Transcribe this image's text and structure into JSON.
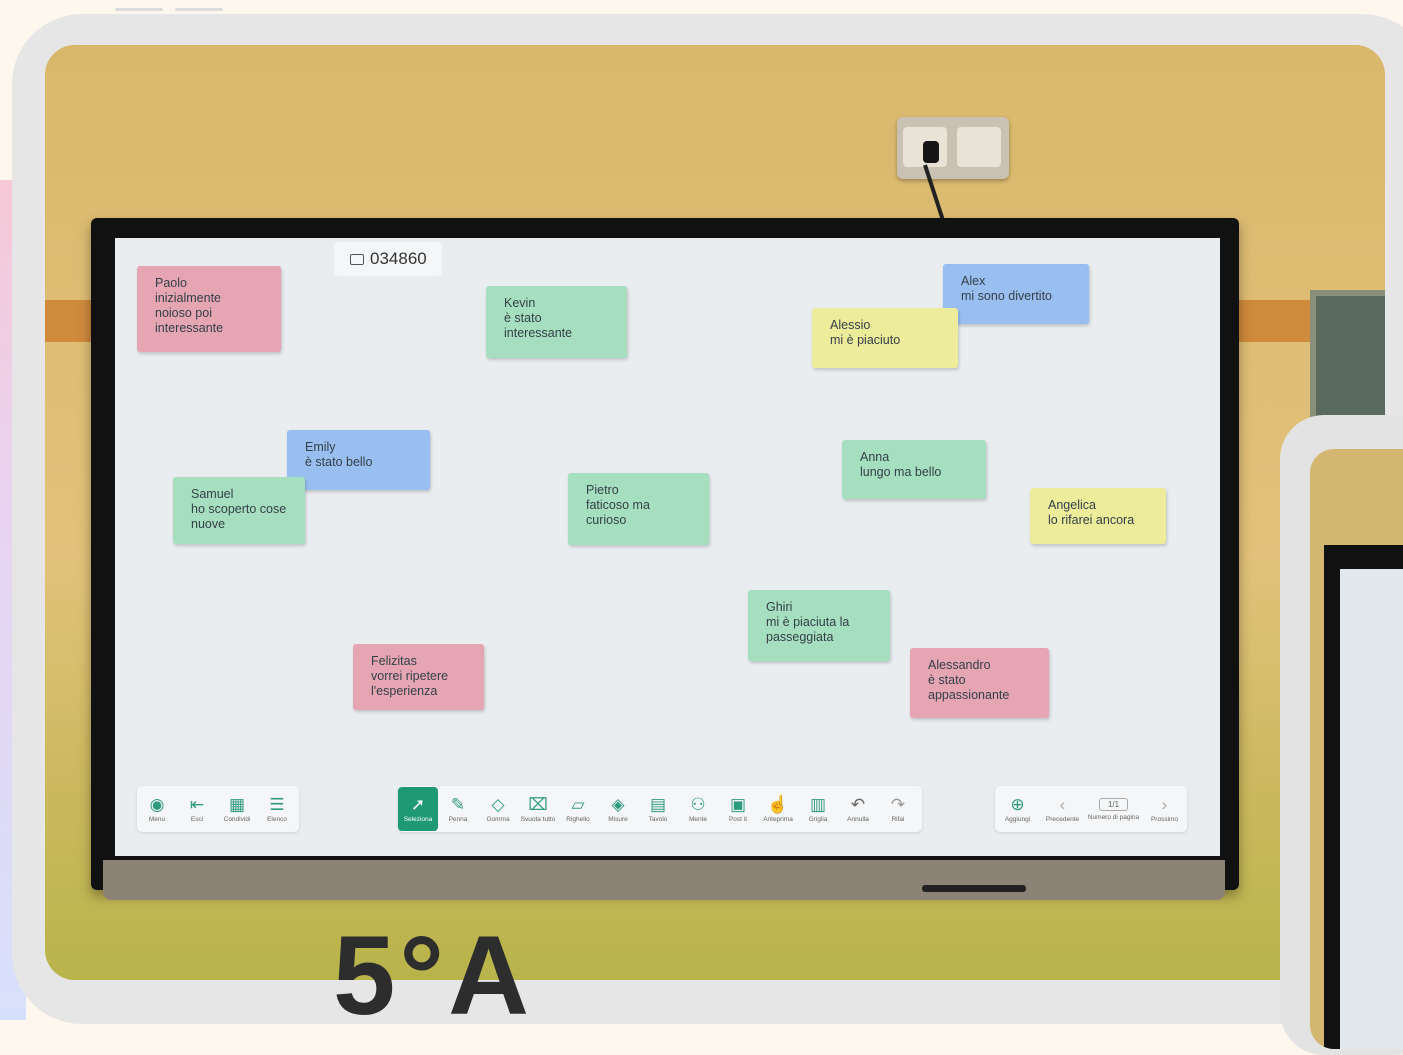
{
  "room_code": "034860",
  "notes": [
    {
      "name": "Paolo",
      "text": "Paolo\ninizialmente\nnoioso poi\ninteressante",
      "color": "#e6a5b2"
    },
    {
      "name": "Kevin",
      "text": "Kevin\nè stato\ninteressante",
      "color": "#a6dfbf"
    },
    {
      "name": "Alex",
      "text": "Alex\nmi sono divertito",
      "color": "#99bef0"
    },
    {
      "name": "Alessio",
      "text": "Alessio\nmi è piaciuto",
      "color": "#ecec9a"
    },
    {
      "name": "Emily",
      "text": "Emily\nè stato bello",
      "color": "#99bef0"
    },
    {
      "name": "Samuel",
      "text": "Samuel\nho scoperto cose\nnuove",
      "color": "#a6dfbf"
    },
    {
      "name": "Pietro",
      "text": "Pietro\nfaticoso ma\ncurioso",
      "color": "#a6dfbf"
    },
    {
      "name": "Anna",
      "text": "Anna\nlungo ma bello",
      "color": "#a6dfbf"
    },
    {
      "name": "Angelica",
      "text": "Angelica\nlo rifarei ancora",
      "color": "#ecec9a"
    },
    {
      "name": "Ghiri",
      "text": "Ghiri\nmi è piaciuta la\npasseggiata",
      "color": "#a6dfbf"
    },
    {
      "name": "Felizitas",
      "text": "Felizitas\nvorrei ripetere\nl'esperienza",
      "color": "#e6a5b2"
    },
    {
      "name": "Alessandro",
      "text": "Alessandro\nè stato\nappassionante",
      "color": "#e6a5b2"
    }
  ],
  "toolbar_left": [
    {
      "label": "Menu",
      "icon": "menu-icon"
    },
    {
      "label": "Esci",
      "icon": "exit-icon"
    },
    {
      "label": "Condividi",
      "icon": "share-icon"
    },
    {
      "label": "Elenco",
      "icon": "list-icon"
    }
  ],
  "toolbar_main": [
    {
      "label": "Seleziona",
      "icon": "select-cursor-icon",
      "active": true
    },
    {
      "label": "Penna",
      "icon": "pen-icon"
    },
    {
      "label": "Gomma",
      "icon": "eraser-icon"
    },
    {
      "label": "Svuota tutto",
      "icon": "clear-all-icon"
    },
    {
      "label": "Righello",
      "icon": "ruler-icon"
    },
    {
      "label": "Misure",
      "icon": "shapes-icon"
    },
    {
      "label": "Tavolo",
      "icon": "table-icon"
    },
    {
      "label": "Mente",
      "icon": "mindmap-icon"
    },
    {
      "label": "Post it",
      "icon": "sticky-note-icon"
    },
    {
      "label": "Anteprima",
      "icon": "preview-icon"
    },
    {
      "label": "Griglia",
      "icon": "grid-icon"
    },
    {
      "label": "Annulla",
      "icon": "undo-icon"
    },
    {
      "label": "Rifai",
      "icon": "redo-icon"
    }
  ],
  "toolbar_pages": {
    "add_label": "Aggiungi",
    "prev_label": "Precedente",
    "page_value": "1/1",
    "page_label": "Numero di pagina",
    "next_label": "Prossimo"
  },
  "class_label": "5°A",
  "colors": {
    "active_tool": "#1f9974",
    "accent_icon": "#2f9a7e"
  }
}
